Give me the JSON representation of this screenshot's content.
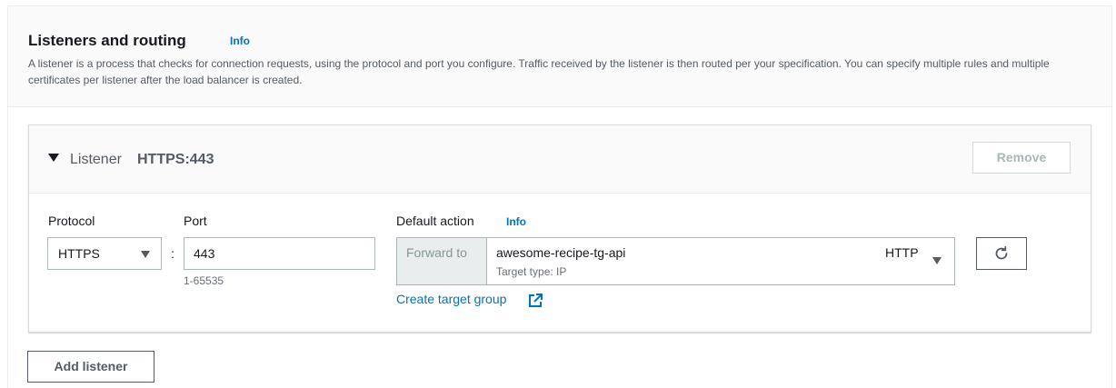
{
  "section": {
    "title": "Listeners and routing",
    "info_label": "Info",
    "description": "A listener is a process that checks for connection requests, using the protocol and port you configure. Traffic received by the listener is then routed per your specification. You can specify multiple rules and multiple certificates per listener after the load balancer is created."
  },
  "listener": {
    "label": "Listener",
    "value": "HTTPS:443",
    "remove_label": "Remove",
    "protocol": {
      "label": "Protocol",
      "selected": "HTTPS"
    },
    "separator": ":",
    "port": {
      "label": "Port",
      "value": "443",
      "hint": "1-65535"
    },
    "default_action": {
      "label": "Default action",
      "info_label": "Info",
      "action": "Forward to",
      "target_group_name": "awesome-recipe-tg-api",
      "target_type": "Target type: IP",
      "target_protocol": "HTTP",
      "create_link": "Create target group"
    }
  },
  "add_listener_label": "Add listener",
  "colors": {
    "link": "#0073bb",
    "border": "#aab7b8",
    "header_bg": "#fafafa",
    "disabled_text": "#aab7b8"
  },
  "icons": [
    "caret-down-icon",
    "dropdown-caret-icon",
    "external-link-icon",
    "refresh-icon"
  ]
}
